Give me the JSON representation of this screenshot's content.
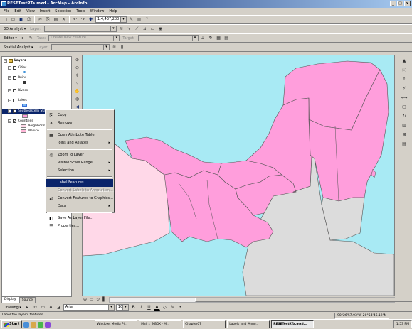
{
  "window": {
    "title": "RESETestRTa.mxd - ArcMap - ArcInfo",
    "buttons": [
      "_",
      "□",
      "×"
    ]
  },
  "menubar": [
    "File",
    "Edit",
    "View",
    "Insert",
    "Selection",
    "Tools",
    "Window",
    "Help"
  ],
  "toolbar1": {
    "scale": "1:4,437,200"
  },
  "toolbar2": {
    "label": "3D Analyst ▾",
    "layer_label": "Layer:"
  },
  "toolbar3": {
    "editor": "Editor ▾",
    "task_label": "Task:",
    "task_value": "Create New Feature",
    "target_label": "Target:"
  },
  "toolbar4": {
    "label": "Spatial Analyst ▾",
    "layer_label": "Layer:"
  },
  "toc": {
    "root": "Layers",
    "layers": [
      {
        "name": "Cities",
        "checked": false
      },
      {
        "name": "Ruins",
        "checked": false
      },
      {
        "name": "Rivers",
        "checked": false
      },
      {
        "name": "Lakes",
        "checked": false
      },
      {
        "name": "Southeastern States",
        "checked": true
      },
      {
        "name": "Countries",
        "checked": true
      }
    ],
    "legend": [
      {
        "label": "Neighboring",
        "color": "#ffd8e8"
      },
      {
        "label": "Mexico",
        "color": "#ffb8d8"
      }
    ],
    "tabs": [
      "Display",
      "Source"
    ]
  },
  "context_menu": {
    "items": [
      {
        "label": "Copy",
        "icon": "copy-icon",
        "glyph": "⎘"
      },
      {
        "label": "Remove",
        "icon": "remove-icon",
        "glyph": "✕"
      },
      {
        "sep": true
      },
      {
        "label": "Open Attribute Table",
        "icon": "table-icon",
        "glyph": "▦"
      },
      {
        "label": "Joins and Relates",
        "submenu": true
      },
      {
        "sep": true
      },
      {
        "label": "Zoom To Layer",
        "icon": "zoom-layer-icon",
        "glyph": "◎"
      },
      {
        "label": "Visible Scale Range",
        "submenu": true
      },
      {
        "label": "Selection",
        "submenu": true
      },
      {
        "sep": true
      },
      {
        "label": "Label Features",
        "highlighted": true
      },
      {
        "label": "Convert Labels to Annotation...",
        "disabled": true
      },
      {
        "label": "Convert Features to Graphics...",
        "icon": "convert-icon",
        "glyph": "⇄"
      },
      {
        "label": "Data",
        "submenu": true
      },
      {
        "sep": true
      },
      {
        "label": "Save As Layer File...",
        "icon": "save-layer-icon",
        "glyph": "◧"
      },
      {
        "label": "Properties...",
        "icon": "properties-icon",
        "glyph": "☰"
      }
    ]
  },
  "draw_toolbar": {
    "drawing": "Drawing ▾",
    "font": "Arial",
    "size": "10",
    "bold": "B",
    "italic": "I",
    "underline": "U",
    "text_tool": "A"
  },
  "status": {
    "message": "Label the layer's features",
    "coords": "90°26'57.93\"W  20°54'46.12\"N"
  },
  "taskbar": {
    "start": "Start",
    "tasks": [
      "Windows Media Pl...",
      "Mail :: INBOX - M...",
      "Chapter07",
      "Labels_and_Anno...",
      "RESETestRTa.mxd..."
    ],
    "active_task": 4,
    "clock": "1:53 PM"
  },
  "map_colors": {
    "ocean": "#a8eaf4",
    "mexico": "#ff9edc",
    "neighboring": "#ffd8e8",
    "other": "#dcdcdc",
    "border": "#555555"
  }
}
